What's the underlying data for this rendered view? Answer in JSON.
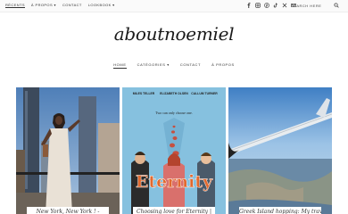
{
  "topnav": {
    "items": [
      {
        "label": "RÉCENTS"
      },
      {
        "label": "À PROPOS ▾"
      },
      {
        "label": "CONTACT"
      },
      {
        "label": "LOOKBOOK ▾"
      }
    ]
  },
  "social_icons": [
    "facebook-icon",
    "instagram-icon",
    "pinterest-icon",
    "tiktok-icon",
    "twitter-icon",
    "email-icon"
  ],
  "search": {
    "label": "SEARCH HERE"
  },
  "logo": {
    "text": "aboutnoemiel"
  },
  "mainnav": {
    "items": [
      {
        "label": "HOME"
      },
      {
        "label": "CATÉGORIES ▾"
      },
      {
        "label": "CONTACT"
      },
      {
        "label": "À PROPOS"
      }
    ]
  },
  "posts": [
    {
      "caption": "New York, New York ! -"
    },
    {
      "caption": "Choosing love for Eternity |"
    },
    {
      "caption": "Greek Island hopping: My travel"
    }
  ],
  "poster": {
    "names": [
      "MILES TELLER",
      "ELIZABETH OLSEN",
      "CALLUM TURNER"
    ],
    "tagline": "Two can only choose one.",
    "title": "Eternity"
  },
  "colors": {
    "accent": "#e07a3c",
    "poster_bg": "#86c1df"
  }
}
